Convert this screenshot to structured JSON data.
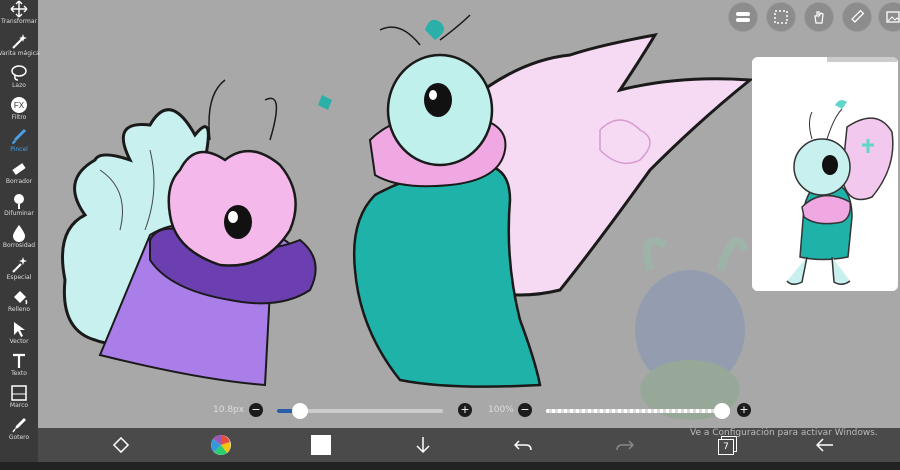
{
  "tools": [
    {
      "id": "transform",
      "label": "Transformar",
      "icon": "move-icon"
    },
    {
      "id": "magic-wand",
      "label": "Varita mágica",
      "icon": "magic-wand-icon"
    },
    {
      "id": "lasso",
      "label": "Lazo",
      "icon": "lasso-icon"
    },
    {
      "id": "filter",
      "label": "Filtro",
      "icon": "fx-icon"
    },
    {
      "id": "brush",
      "label": "Pincel",
      "icon": "brush-icon",
      "active": true
    },
    {
      "id": "eraser",
      "label": "Borrador",
      "icon": "eraser-icon"
    },
    {
      "id": "blur",
      "label": "Difuminar",
      "icon": "blur-icon"
    },
    {
      "id": "blurriness",
      "label": "Borrosidad",
      "icon": "drop-icon"
    },
    {
      "id": "special",
      "label": "Especial",
      "icon": "special-icon"
    },
    {
      "id": "fill",
      "label": "Relleno",
      "icon": "fill-icon"
    },
    {
      "id": "vector",
      "label": "Vector",
      "icon": "vector-icon"
    },
    {
      "id": "text",
      "label": "Texto",
      "icon": "text-icon"
    },
    {
      "id": "frame",
      "label": "Marco",
      "icon": "frame-icon"
    },
    {
      "id": "eyedropper",
      "label": "Gotero",
      "icon": "eyedropper-icon"
    }
  ],
  "brush_size": {
    "label": "10.8px",
    "value": 0.14
  },
  "opacity": {
    "label": "100%",
    "value": 1.0
  },
  "layer_count": "7",
  "watermark": "Ve a Configuración para activar Windows.",
  "colors": {
    "toolbar": "#3a3a3a",
    "accent": "#4aa0e6",
    "canvas": "#a8a8a8"
  }
}
